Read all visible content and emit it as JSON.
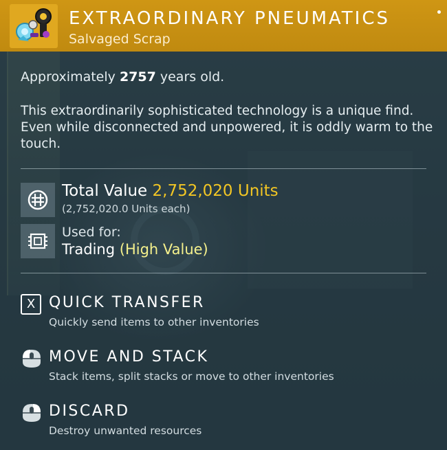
{
  "item": {
    "title": "EXTRAORDINARY PNEUMATICS",
    "category": "Salvaged Scrap",
    "age_prefix": "Approximately",
    "age_value": "2757",
    "age_suffix": "years old.",
    "description": "This extraordinarily sophisticated technology is a unique find. Even while disconnected and unpowered, it is oddly warm to the touch."
  },
  "value": {
    "label": "Total Value",
    "amount": "2,752,020 Units",
    "each": "(2,752,020.0 Units each)",
    "icon": "units-icon"
  },
  "usage": {
    "label": "Used for:",
    "value": "Trading",
    "qualifier": "(High Value)",
    "icon": "chip-icon"
  },
  "actions": [
    {
      "key": "X",
      "title": "QUICK TRANSFER",
      "subtitle": "Quickly send items to other inventories",
      "icon": "x-key-icon"
    },
    {
      "title": "MOVE AND STACK",
      "subtitle": "Stack items, split stacks or move to other inventories",
      "icon": "mouse-left-icon"
    },
    {
      "title": "DISCARD",
      "subtitle": "Destroy unwanted resources",
      "icon": "mouse-right-icon"
    }
  ],
  "colors": {
    "header": "#c58d12",
    "gold": "#f2c624",
    "highlight": "#f4f08c"
  }
}
